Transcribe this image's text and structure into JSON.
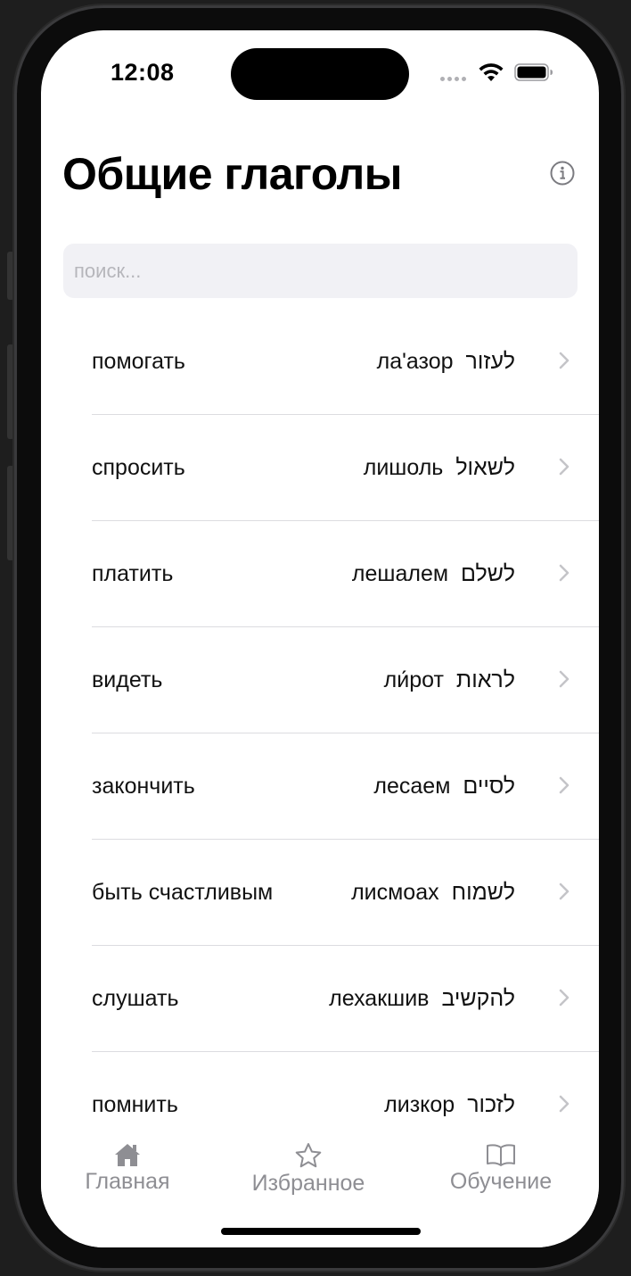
{
  "status_bar": {
    "time": "12:08"
  },
  "header": {
    "title": "Общие глаголы"
  },
  "search": {
    "placeholder": "поиск..."
  },
  "verbs": [
    {
      "ru": "помогать",
      "translit": "ла'азор",
      "he": "לעזור"
    },
    {
      "ru": "спросить",
      "translit": "лишоль",
      "he": "לשאול"
    },
    {
      "ru": "платить",
      "translit": "лешалем",
      "he": "לשלם"
    },
    {
      "ru": "видеть",
      "translit": "ли́рот",
      "he": "לראות"
    },
    {
      "ru": "закончить",
      "translit": "лесаем",
      "he": "לסיים"
    },
    {
      "ru": "быть счастливым",
      "translit": "лисмоах",
      "he": "לשמוח"
    },
    {
      "ru": "слушать",
      "translit": "лехакшив",
      "he": "להקשיב"
    },
    {
      "ru": "помнить",
      "translit": "лизкор",
      "he": "לזכור"
    }
  ],
  "tabbar": {
    "tabs": [
      {
        "label": "Главная",
        "icon": "house-icon"
      },
      {
        "label": "Избранное",
        "icon": "star-icon"
      },
      {
        "label": "Обучение",
        "icon": "book-icon"
      }
    ]
  },
  "colors": {
    "tab_inactive": "#8e8e93",
    "search_bg": "#f1f1f5",
    "divider": "#dcdce0"
  }
}
